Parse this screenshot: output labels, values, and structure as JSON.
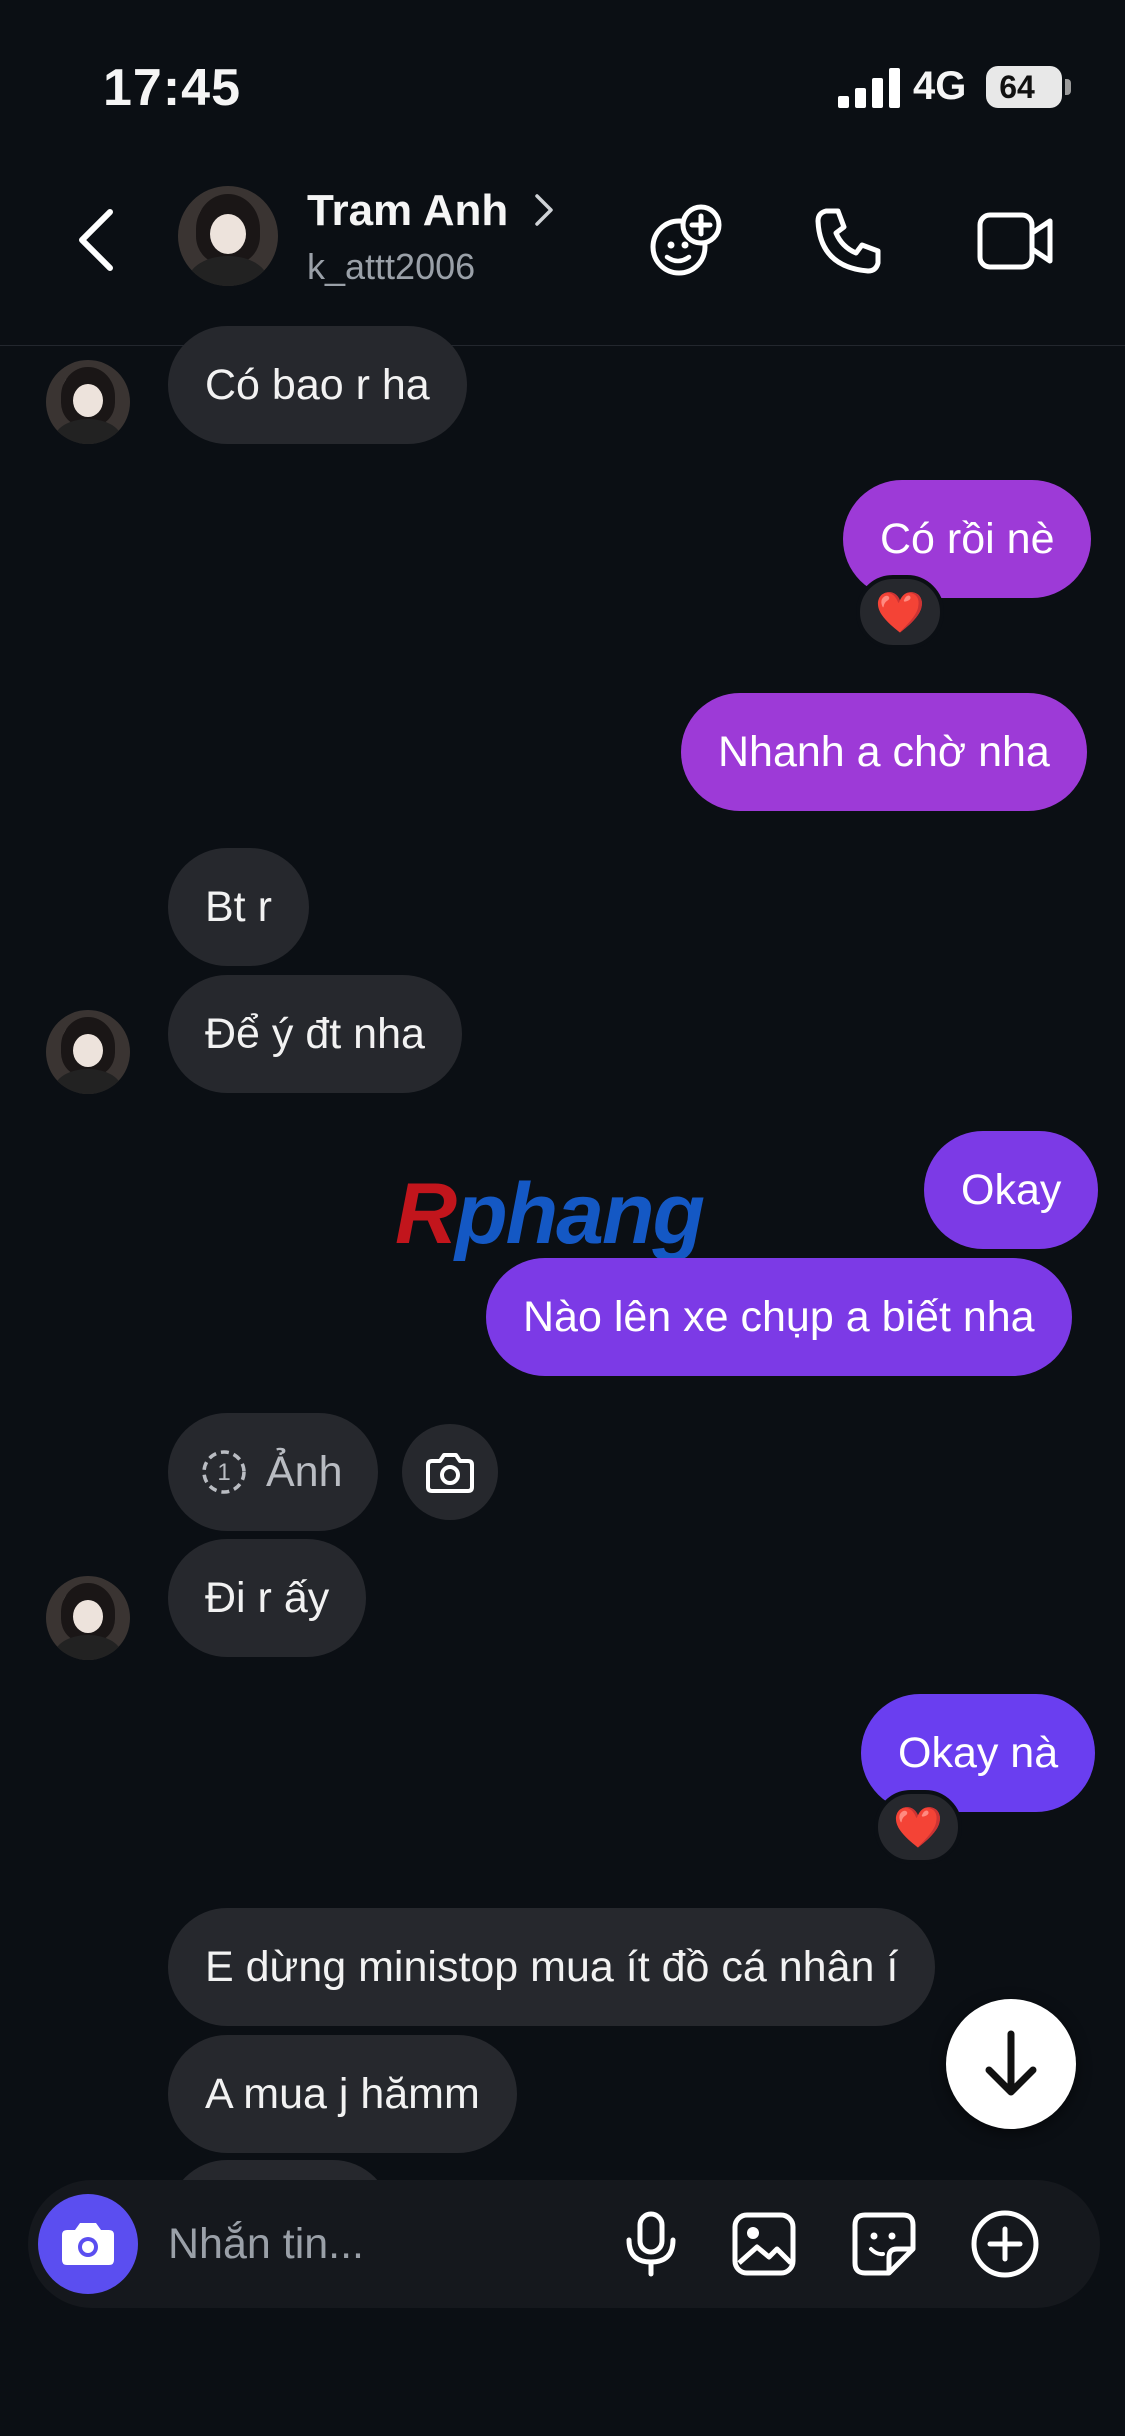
{
  "status_bar": {
    "time": "17:45",
    "network": "4G",
    "battery": "64"
  },
  "header": {
    "name": "Tram Anh",
    "handle": "k_attt2006"
  },
  "messages": [
    {
      "text": "Có bao r ha"
    },
    {
      "text": "Có rồi nè",
      "reaction": "❤️"
    },
    {
      "text": "Nhanh a chờ nha"
    },
    {
      "text": "Bt r"
    },
    {
      "text": "Để ý đt nha"
    },
    {
      "text": "Okay"
    },
    {
      "text": "Nào lên xe chụp a biết nha"
    },
    {
      "photo_count": "1",
      "photo_label": "Ảnh"
    },
    {
      "text": "Đi r ấy"
    },
    {
      "text": "Okay nà",
      "reaction": "❤️"
    },
    {
      "text": "E dừng ministop mua ít đồ cá nhân í"
    },
    {
      "text": "A mua j hămm"
    }
  ],
  "watermark": {
    "first": "R",
    "rest": "phang"
  },
  "composer": {
    "placeholder": "Nhắn tin..."
  },
  "colors": {
    "background": "#0b0f14",
    "incoming_bubble": "#26282d",
    "outgoing_purple": "#9d3ad7",
    "outgoing_violet": "#7c3ae6",
    "outgoing_indigo": "#6a3ef0",
    "camera_button": "#5b4ef0"
  }
}
